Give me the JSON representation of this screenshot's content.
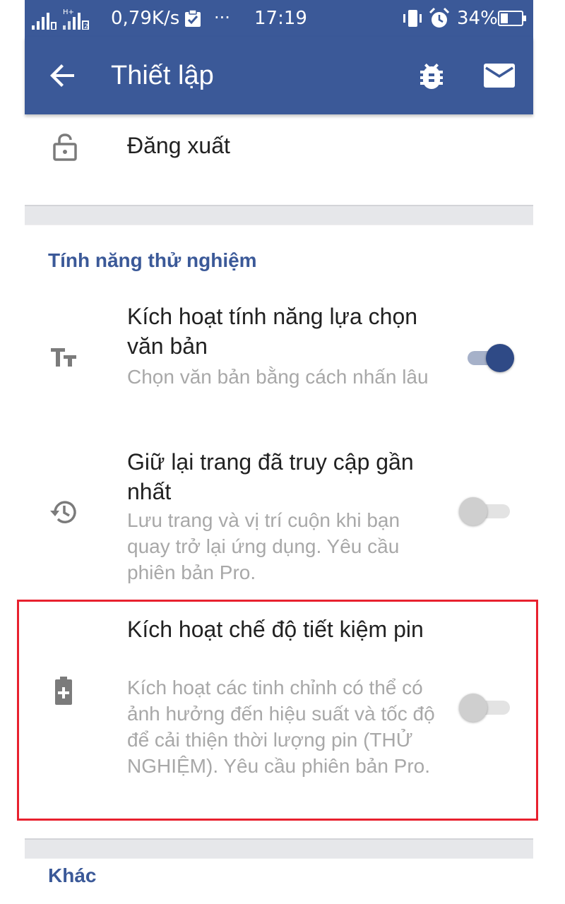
{
  "status_bar": {
    "network_speed": "0,79K/s",
    "overflow": "···",
    "time": "17:19",
    "battery_percent": "34%",
    "battery_level": 0.34
  },
  "app_bar": {
    "title": "Thiết lập",
    "color": "#3b5998"
  },
  "logout": {
    "label": "Đăng xuất"
  },
  "experimental": {
    "header": "Tính năng thử nghiệm",
    "items": [
      {
        "icon": "text-size-icon",
        "title": "Kích hoạt tính năng lựa chọn văn bản",
        "description": "Chọn văn bản bằng cách nhấn lâu",
        "enabled": true
      },
      {
        "icon": "history-icon",
        "title": "Giữ lại trang đã truy cập gần nhất",
        "description": "Lưu trang và vị trí cuộn khi bạn quay trở lại ứng dụng. Yêu cầu phiên bản Pro.",
        "enabled": false
      },
      {
        "icon": "battery-plus-icon",
        "title": "Kích hoạt chế độ tiết kiệm pin",
        "description": "Kích hoạt các tinh chỉnh có thể có ảnh hưởng đến hiệu suất và tốc độ để cải thiện thời lượng pin (THỬ NGHIỆM). Yêu cầu phiên bản Pro.",
        "enabled": false
      }
    ]
  },
  "other": {
    "header": "Khác"
  },
  "colors": {
    "accent": "#3b5998",
    "toggle_on": "#2f4a86",
    "highlight": "#e8212f"
  }
}
